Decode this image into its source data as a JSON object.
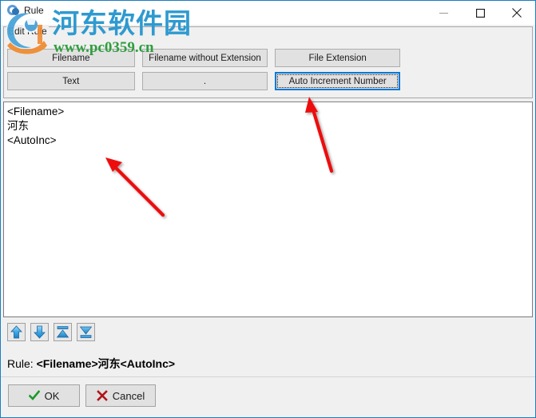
{
  "window": {
    "title": "Rule",
    "icon": "app-icon",
    "controls": {
      "minimize": "minimize-icon",
      "maximize": "maximize-icon",
      "close": "close-icon"
    }
  },
  "groupbox": {
    "label": "Edit Rule",
    "buttons": [
      {
        "id": "filename",
        "label": "Filename",
        "focused": false
      },
      {
        "id": "filename-without-extension",
        "label": "Filename without Extension",
        "focused": false
      },
      {
        "id": "file-extension",
        "label": "File Extension",
        "focused": false
      },
      {
        "id": "text",
        "label": "Text",
        "focused": false
      },
      {
        "id": "dot",
        "label": ".",
        "focused": false
      },
      {
        "id": "auto-increment-number",
        "label": "Auto Increment Number",
        "focused": true
      }
    ]
  },
  "editor": {
    "lines": [
      "<Filename>",
      "河东",
      "<AutoInc>"
    ]
  },
  "order_toolbar": {
    "buttons": [
      {
        "id": "move-up",
        "icon": "arrow-up-icon"
      },
      {
        "id": "move-down",
        "icon": "arrow-down-icon"
      },
      {
        "id": "move-to-top",
        "icon": "arrow-to-top-icon"
      },
      {
        "id": "move-to-bottom",
        "icon": "arrow-to-bottom-icon"
      }
    ]
  },
  "rule_preview": {
    "label": "Rule: ",
    "value": "<Filename>河东<AutoInc>"
  },
  "footer": {
    "ok_label": "OK",
    "cancel_label": "Cancel",
    "ok_icon": "check-icon",
    "cancel_icon": "cross-icon"
  },
  "watermark": {
    "site_name": "河东软件园",
    "url": "www.pc0359.cn",
    "site_color": "#2e9ad0",
    "url_color": "#2f9e3f"
  },
  "annotations": {
    "arrow_color": "#ee1111",
    "arrows": [
      {
        "id": "arrow-to-editor",
        "points_to": "editor-text"
      },
      {
        "id": "arrow-to-auto-increment",
        "points_to": "auto-increment-number-button"
      }
    ]
  },
  "colors": {
    "window_border": "#1a7dc4",
    "focus_border": "#0078d7",
    "button_face": "#e1e1e1",
    "dialog_face": "#f0f0f0"
  }
}
